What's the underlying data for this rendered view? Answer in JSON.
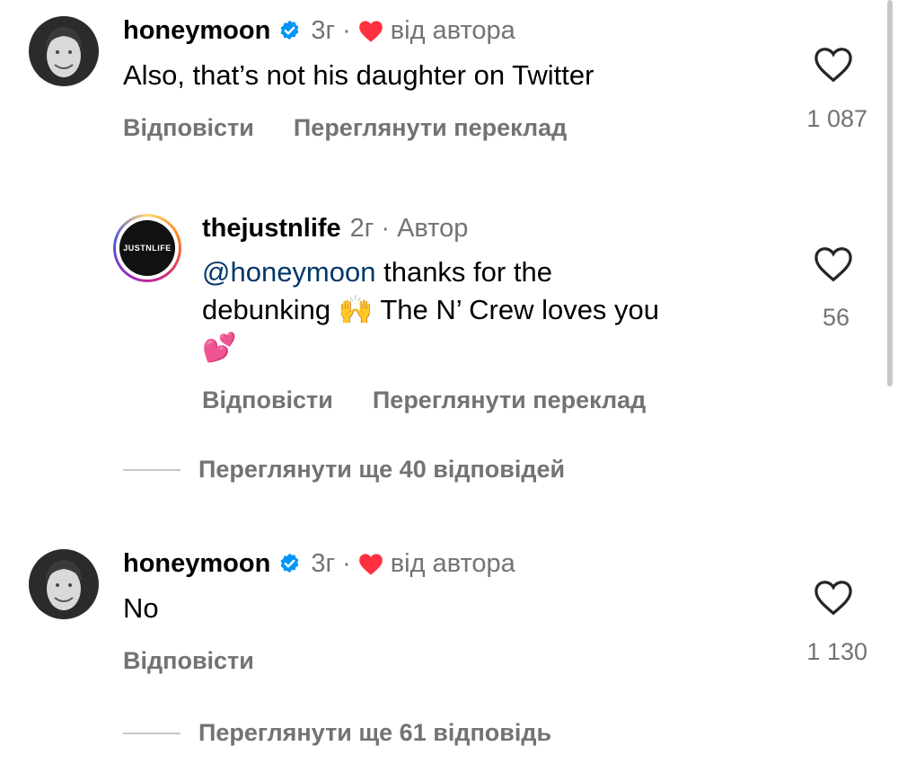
{
  "comments": [
    {
      "username": "honeymoon",
      "time": "3г",
      "separator": "·",
      "author_like_label": "від автора",
      "text": "Also, that’s not his daughter on Twitter",
      "reply_label": "Відповісти",
      "translate_label": "Переглянути переклад",
      "like_count": "1 087",
      "avatar_icon": "profile-photo-icon",
      "verified_icon": "verified-badge-icon"
    },
    {
      "username": "thejustnlife",
      "time": "2г",
      "separator": "·",
      "author_tag": "Автор",
      "mention": "@honeymoon",
      "text_line1": " thanks for the",
      "text_line2": "debunking ",
      "emoji_hands": "🙌",
      "text_line2b": " The N’ Crew loves you",
      "emoji_hearts": "💕",
      "avatar_text": "JUSTNLIFE",
      "reply_label": "Відповісти",
      "translate_label": "Переглянути переклад",
      "like_count": "56"
    },
    {
      "username": "honeymoon",
      "time": "3г",
      "separator": "·",
      "author_like_label": "від автора",
      "text": "No",
      "reply_label": "Відповісти",
      "like_count": "1 130"
    }
  ],
  "view_more_1": "Переглянути ще 40 відповідей",
  "view_more_2": "Переглянути ще 61 відповідь",
  "colors": {
    "secondary_text": "#737373",
    "verified_blue": "#0095f6",
    "heart_red": "#ff3040",
    "mention_blue": "#00376b"
  }
}
